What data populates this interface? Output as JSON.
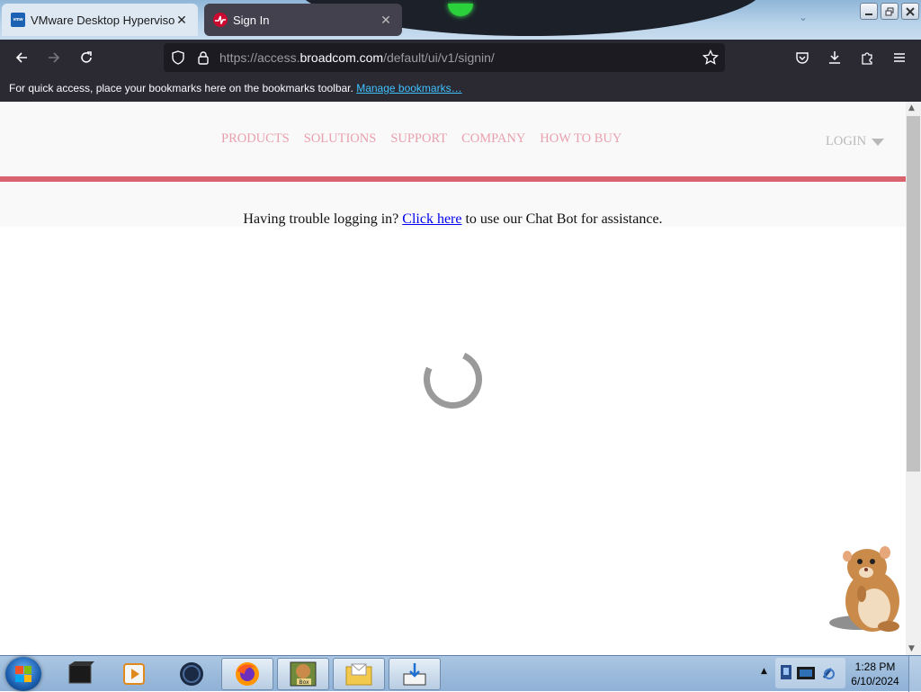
{
  "browser": {
    "tabs": [
      {
        "title": "VMware Desktop Hypervisors fo",
        "favicon": "vmware-favicon",
        "favicon_text": "vmw"
      },
      {
        "title": "Sign In",
        "favicon": "broadcom-favicon"
      }
    ],
    "url": {
      "prefix": "https://access.",
      "host": "broadcom.com",
      "path": "/default/ui/v1/signin/"
    },
    "bookmarks": {
      "message": "For quick access, place your bookmarks here on the bookmarks toolbar.",
      "manage_link": "Manage bookmarks…"
    }
  },
  "site": {
    "nav": [
      "PRODUCTS",
      "SOLUTIONS",
      "SUPPORT",
      "COMPANY",
      "HOW TO BUY"
    ],
    "login": "LOGIN",
    "notice": {
      "before": "Having trouble logging in?",
      "link": "Click here",
      "after": "to use our Chat Bot for assistance."
    },
    "colors": {
      "accent": "#d9636f",
      "nav_text": "#e8a0ae"
    }
  },
  "taskbar": {
    "clock": {
      "time": "1:28 PM",
      "date": "6/10/2024"
    },
    "apps": [
      "terminal-app",
      "media-player-app",
      "dark-globe-app",
      "firefox-app",
      "hamster-box-app",
      "mail-app",
      "download-app"
    ],
    "box_label": "Box"
  }
}
